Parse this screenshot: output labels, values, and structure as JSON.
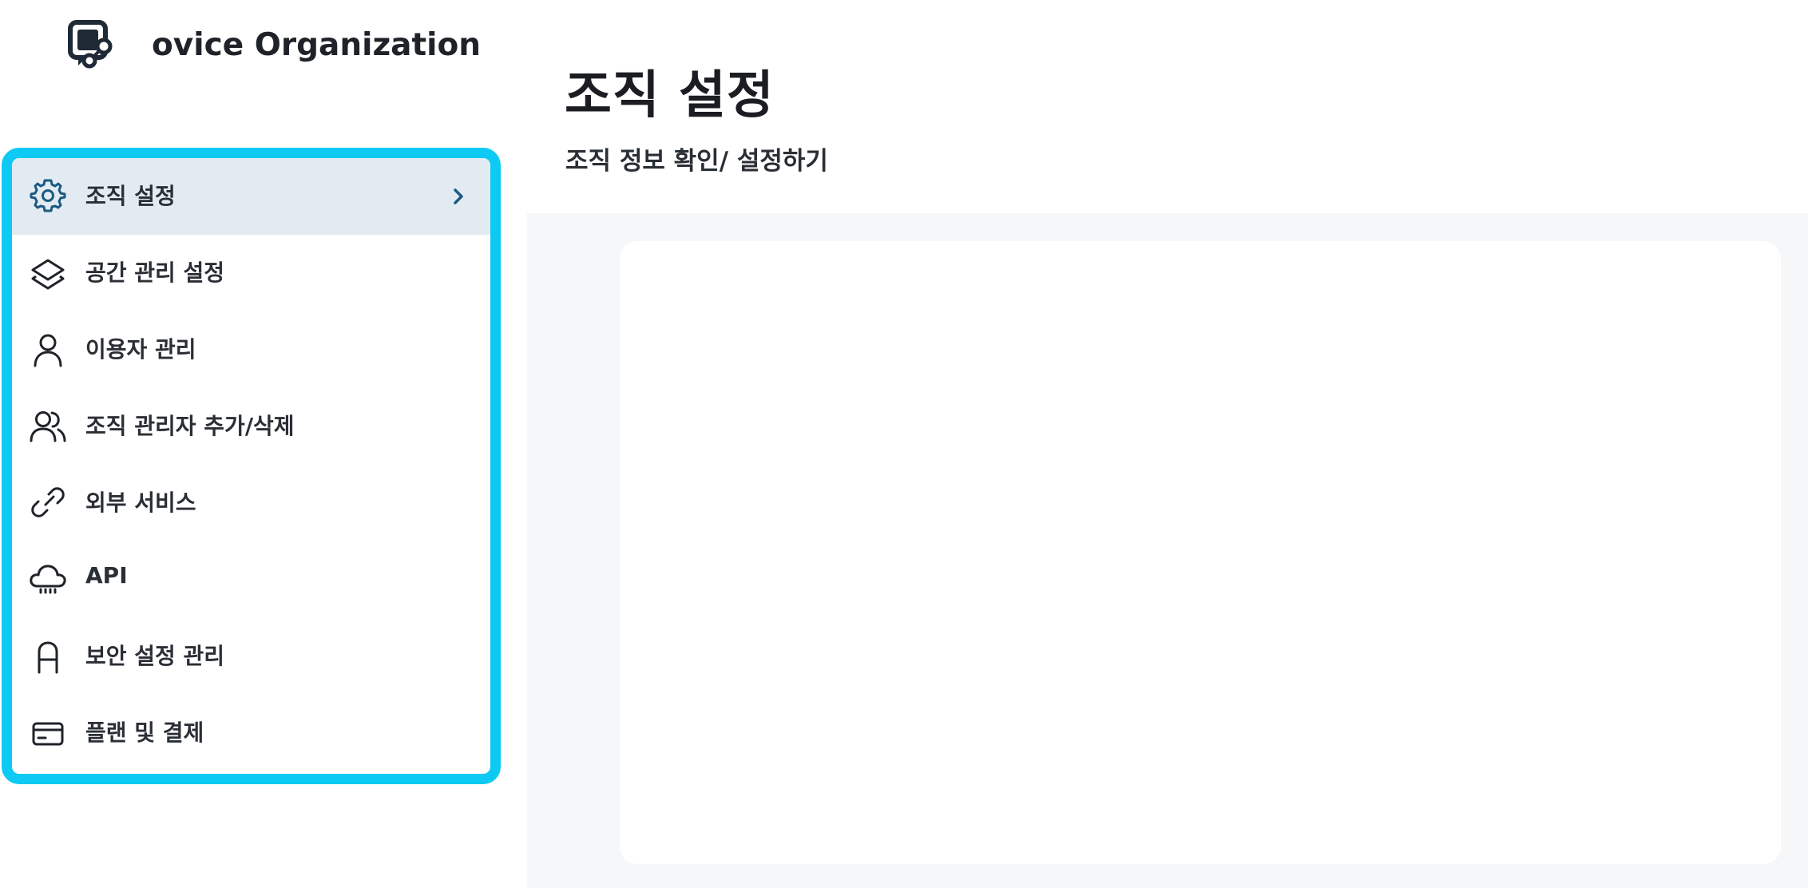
{
  "organization": {
    "name": "ovice Organization",
    "logo_icon": "ovice-logo-icon"
  },
  "sidebar": {
    "items": [
      {
        "label": "조직 설정",
        "icon": "gear-icon",
        "active": true
      },
      {
        "label": "공간 관리 설정",
        "icon": "layers-icon",
        "active": false
      },
      {
        "label": "이용자 관리",
        "icon": "user-icon",
        "active": false
      },
      {
        "label": "조직 관리자 추가/삭제",
        "icon": "users-icon",
        "active": false
      },
      {
        "label": "외부 서비스",
        "icon": "link-icon",
        "active": false
      },
      {
        "label": "API",
        "icon": "cloud-icon",
        "active": false
      },
      {
        "label": "보안 설정 관리",
        "icon": "lock-icon",
        "active": false
      },
      {
        "label": "플랜 및 결제",
        "icon": "credit-card-icon",
        "active": false
      }
    ]
  },
  "main": {
    "title": "조직 설정",
    "subtitle": "조직 정보 확인/ 설정하기"
  },
  "colors": {
    "highlight_border": "#0ccaf3",
    "active_item_bg": "#e3ebf2",
    "accent_icon": "#1a5a82",
    "content_bg": "#f6f7f9"
  }
}
